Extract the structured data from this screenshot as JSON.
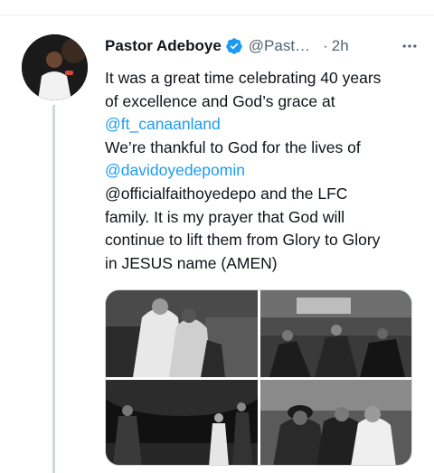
{
  "tweet": {
    "author_name": "Pastor Adeboye",
    "handle": "@Past…",
    "separator": "·",
    "time": "2h",
    "more_icon": "more-horizontal-icon",
    "verified_icon": "verified-badge-icon",
    "body": {
      "l1": "It was a great time celebrating 40 years",
      "l2": "of excellence and God’s grace at",
      "l3": "@ft_canaanland",
      "l4": "We’re thankful to God for the lives of",
      "l5": "@davidoyedepomin",
      "l6": "@officialfaithoyedepo and the LFC",
      "l7": "family. It is my prayer that God will",
      "l8": "continue to lift them from Glory to Glory",
      "l9": "in JESUS name (AMEN)"
    }
  },
  "colors": {
    "link": "#1d9bf0",
    "secondary_text": "#536471",
    "verified": "#1d9bf0"
  }
}
